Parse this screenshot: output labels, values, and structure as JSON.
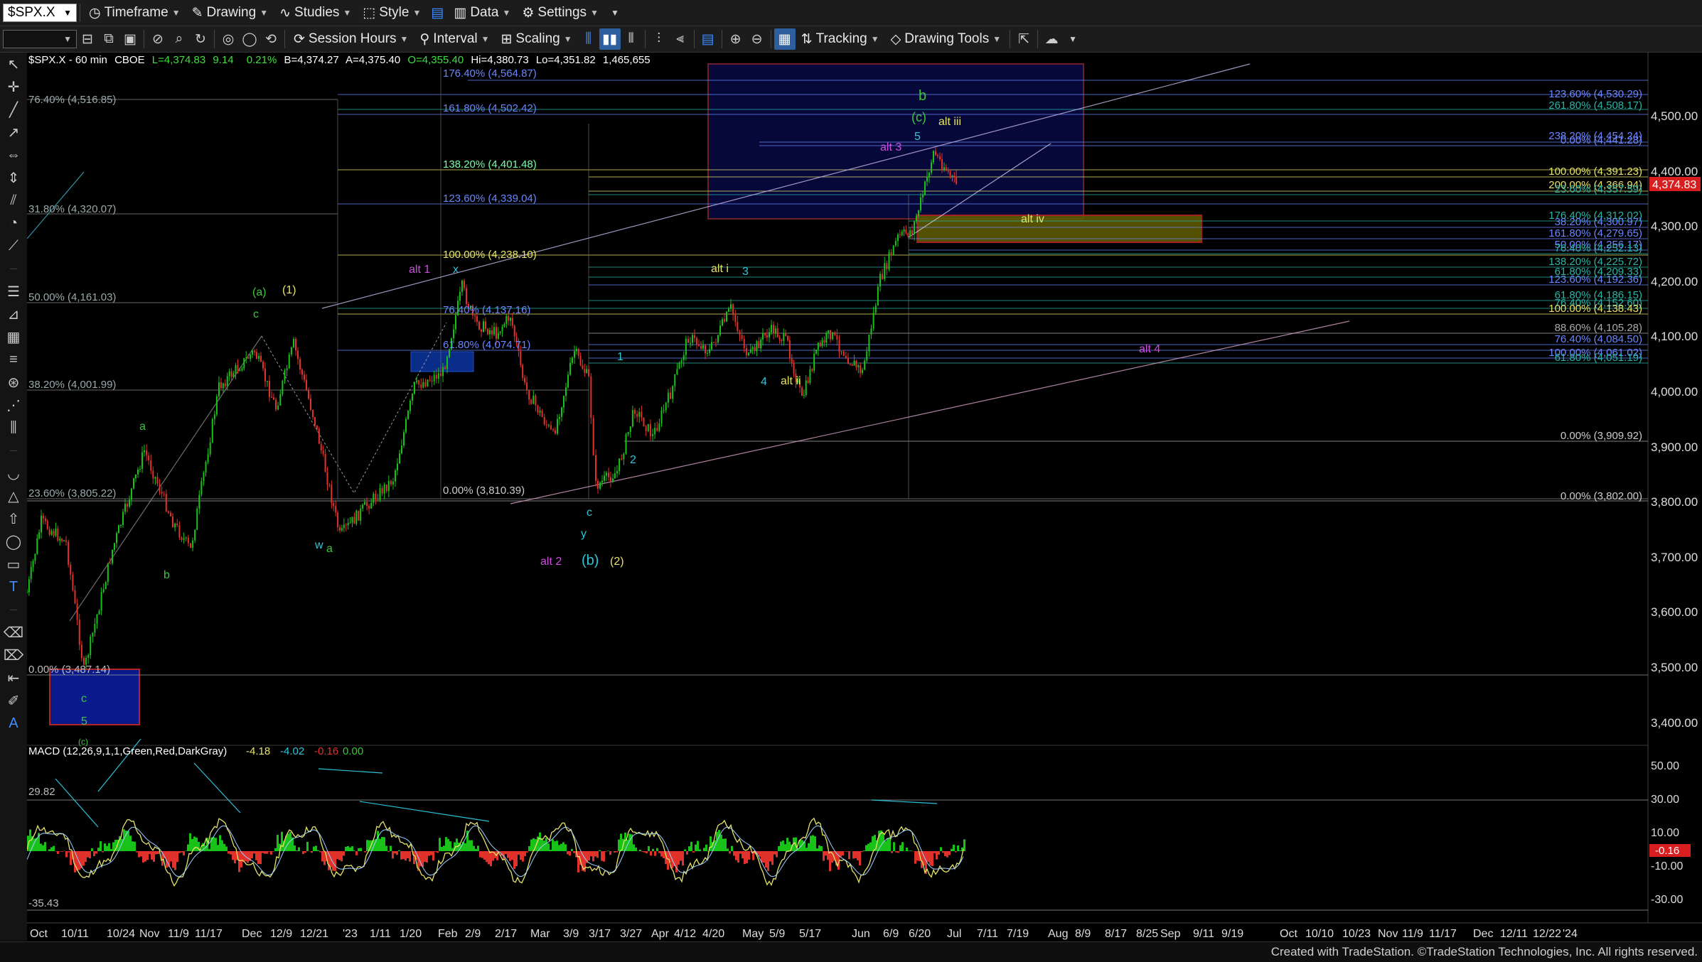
{
  "toolbar": {
    "symbol": "$SPX.X",
    "timeframe": "Timeframe",
    "drawing": "Drawing",
    "studies": "Studies",
    "style": "Style",
    "data": "Data",
    "settings": "Settings",
    "session_hours": "Session Hours",
    "interval": "Interval",
    "scaling": "Scaling",
    "tracking": "Tracking",
    "drawing_tools": "Drawing Tools"
  },
  "header": {
    "symbol": "$SPX.X - 60 min",
    "exchange": "CBOE",
    "last": "L=4,374.83",
    "change": "9.14",
    "pct": "0.21%",
    "bid": "B=4,374.27",
    "ask": "A=4,375.40",
    "open": "O=4,355.40",
    "high": "Hi=4,380.73",
    "low": "Lo=4,351.82",
    "volume": "1,465,655"
  },
  "price_axis": {
    "ticks": [
      "4,500.00",
      "4,400.00",
      "4,300.00",
      "4,200.00",
      "4,100.00",
      "4,000.00",
      "3,900.00",
      "3,800.00",
      "3,700.00",
      "3,600.00",
      "3,500.00",
      "3,400.00"
    ],
    "last_price": "4,374.83"
  },
  "macd": {
    "label": "MACD (12,26,9,1,1,Green,Red,DarkGray)",
    "v1": "-4.18",
    "v2": "-4.02",
    "v3": "-0.16",
    "v4": "0.00",
    "left_top": "29.82",
    "left_bottom": "-35.43",
    "ticks": [
      "50.00",
      "30.00",
      "10.00",
      "-10.00",
      "-30.00"
    ],
    "badge": "-0.16"
  },
  "time_axis": [
    "Oct",
    "10/11",
    "10/24",
    "Nov",
    "11/9",
    "11/17",
    "Dec",
    "12/9",
    "12/21",
    "'23",
    "1/11",
    "1/20",
    "Feb",
    "2/9",
    "2/17",
    "Mar",
    "3/9",
    "3/17",
    "3/27",
    "Apr",
    "4/12",
    "4/20",
    "May",
    "5/9",
    "5/17",
    "Jun",
    "6/9",
    "6/20",
    "Jul",
    "7/11",
    "7/19",
    "Aug",
    "8/9",
    "8/17",
    "8/25",
    "Sep",
    "9/11",
    "9/19",
    "Oct",
    "10/10",
    "10/23",
    "Nov",
    "11/9",
    "11/17",
    "Dec",
    "12/11",
    "12/22",
    "'24"
  ],
  "fib_labels": {
    "l_176": "176.40% (4,564.87)",
    "l_7640": "76.40% (4,516.85)",
    "l_1618": "161.80% (4,502.42)",
    "l_1382": "138.20% (4,401.48)",
    "l_1236": "123.60% (4,339.04)",
    "l_3180": "31.80% (4,320.07)",
    "l_100": "100.00% (4,238.10)",
    "l_50": "50.00% (4,161.03)",
    "l_764b": "76.40% (4,137.16)",
    "l_618": "61.80% (4,074.71)",
    "l_382": "38.20% (4,001.99)",
    "l_236": "23.60% (3,805.22)",
    "l_zero1": "0.00% (3,810.39)",
    "l_zero2": "0.00% (3,487.14)",
    "r_12360": "123.60% (4,530.29)",
    "r_26180": "261.80% (4,508.17)",
    "r_23820": "238.20% (4,454.24)",
    "r_xx": "0.00% (4,441.28)",
    "r_100": "100.00% (4,391.23)",
    "r_200": "200.00% (4,366.94)",
    "r_2360": "23.60% (4,357.59)",
    "r_1764": "176.40% (4,312.02)",
    "r_382": "38.20% (4,300.97)",
    "r_1618": "161.80% (4,279.65)",
    "r_5040": "50.00% (4,256.17)",
    "r_7640": "76.40% (4,252.13)",
    "r_1382": "138.20% (4,225.72)",
    "r_1236": "123.60% (4,192.36)",
    "r_6180b": "61.80% (4,186.15)",
    "r_7640b": "76.40% (4,152.60)",
    "r_6180": "61.80% (4,209.33)",
    "r_100b": "100.00% (4,138.43)",
    "r_886": "88.60% (4,105.28)",
    "r_7640c": "76.40% (4,084.50)",
    "r_100c": "100.00% (4,061.02)",
    "r_618c": "61.80% (4,051.19)",
    "r_zero": "0.00% (3,909.92)",
    "r_zero2": "0.00% (3,802.00)"
  },
  "wave_labels": {
    "b_top": "b",
    "c_paren": "(c)",
    "alt_iii": "alt iii",
    "five": "5",
    "alt_3": "alt 3",
    "alt_iv": "alt iv",
    "alt_1": "alt 1",
    "x": "x",
    "alt_i": "alt i",
    "three": "3",
    "one": "1",
    "four": "4",
    "alt_ii": "alt ii",
    "alt_4": "alt 4",
    "two": "2",
    "c_low": "c",
    "y": "y",
    "b_paren": "(b)",
    "two_paren": "(2)",
    "alt_2": "alt 2",
    "a_paren": "(a)",
    "one_paren": "(1)",
    "c_mid": "c",
    "a_left": "a",
    "b_left": "b",
    "w": "w",
    "a_w": "a",
    "c_box": "c",
    "five_box": "5",
    "c_partial": "(c)"
  },
  "credit": "Created with TradeStation. ©TradeStation Technologies, Inc. All rights reserved.",
  "colors": {
    "up": "#19c219",
    "down": "#e0312b",
    "fib_blue": "#6b86ff",
    "fib_yellow": "#e6e36a",
    "magenta": "#d04ce0",
    "cyan": "#31c4d8",
    "green_label": "#7fd13a"
  }
}
